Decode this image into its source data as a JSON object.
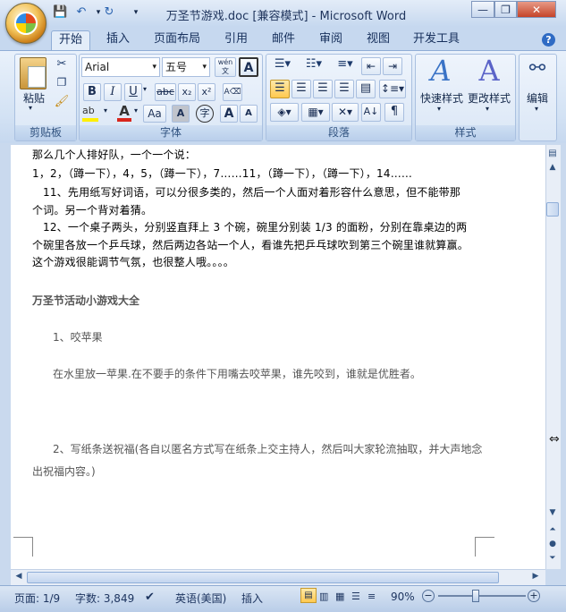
{
  "window": {
    "title": "万圣节游戏.doc [兼容模式] - Microsoft Word",
    "minimize_glyph": "—",
    "restore_glyph": "❐",
    "close_glyph": "✕"
  },
  "qat": {
    "save_icon": "save-icon",
    "undo_icon": "undo-icon",
    "redo_icon": "redo-icon"
  },
  "tabs": [
    "开始",
    "插入",
    "页面布局",
    "引用",
    "邮件",
    "审阅",
    "视图",
    "开发工具"
  ],
  "ribbon": {
    "clipboard": {
      "label": "剪贴板",
      "paste": "粘贴"
    },
    "font": {
      "label": "字体",
      "font_name": "Arial",
      "font_size": "五号",
      "bold": "B",
      "italic": "I",
      "underline": "U",
      "strike": "abc",
      "subscript": "x₂",
      "superscript": "x²",
      "case": "Aa",
      "grow": "A",
      "shrink": "A",
      "phonetic": "wén 文",
      "border": "A",
      "char_shade": "A",
      "enclose": "字"
    },
    "paragraph": {
      "label": "段落"
    },
    "styles": {
      "label": "样式",
      "quick": "快速样式",
      "change": "更改样式"
    },
    "editing": {
      "label": "编辑"
    }
  },
  "document": {
    "lines": [
      "那么几个人排好队，一个一个说：",
      "1，2，（蹲一下），4，5，（蹲一下），7……11，（蹲一下），（蹲一下），14……",
      "11、先用纸写好词语，可以分很多类的，然后一个人面对着形容什么意思，但不能带那",
      "个词。另一个背对着猜。",
      "12、一个桌子两头，分别竖直拜上 3 个碗，碗里分别装 1/3 的面粉，分别在靠桌边的两",
      "个碗里各放一个乒乓球，然后两边各站一个人，看谁先把乒乓球吹到第三个碗里谁就算赢。",
      "这个游戏很能调节气氛，也很整人哦。。。。"
    ],
    "heading": "万圣节活动小游戏大全",
    "item1_title": "1、咬苹果",
    "item1_body": "在水里放一苹果.在不要手的条件下用嘴去咬苹果，谁先咬到，谁就是优胜者。",
    "item2_line1": "2、写纸条送祝福(各自以匿名方式写在纸条上交主持人，然后叫大家轮流抽取，并大声地念",
    "item2_line2": "出祝福内容。)"
  },
  "status": {
    "page": "页面: 1/9",
    "words": "字数: 3,849",
    "language": "英语(美国)",
    "mode": "插入",
    "zoom": "90%"
  }
}
